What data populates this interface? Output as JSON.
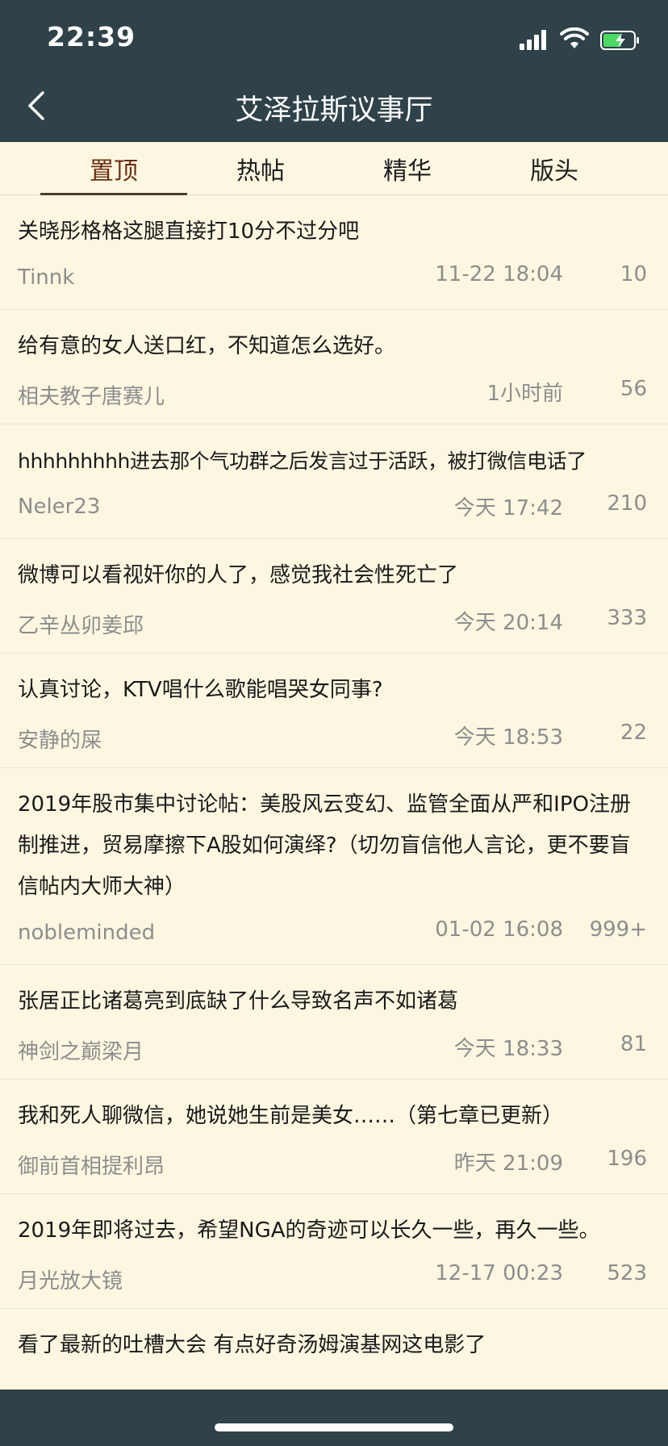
{
  "status_bar": {
    "time": "22:39"
  },
  "header": {
    "title": "艾泽拉斯议事厅"
  },
  "tabs": [
    {
      "label": "置顶",
      "active": true
    },
    {
      "label": "热帖",
      "active": false
    },
    {
      "label": "精华",
      "active": false
    },
    {
      "label": "版头",
      "active": false
    }
  ],
  "posts": [
    {
      "title": "关晓彤格格这腿直接打10分不过分吧",
      "author": "Tinnk",
      "time": "11-22 18:04",
      "count": "10"
    },
    {
      "title": "给有意的女人送口红，不知道怎么选好。",
      "author": "相夫教子唐赛儿",
      "time": "1小时前",
      "count": "56"
    },
    {
      "title": "hhhhhhhhh进去那个气功群之后发言过于活跃，被打微信电话了",
      "author": "Neler23",
      "time": "今天 17:42",
      "count": "210"
    },
    {
      "title": "微博可以看视奸你的人了，感觉我社会性死亡了",
      "author": "乙辛丛卯姜邱",
      "time": "今天 20:14",
      "count": "333"
    },
    {
      "title": "认真讨论，KTV唱什么歌能唱哭女同事?",
      "author": "安静的屎",
      "time": "今天 18:53",
      "count": "22"
    },
    {
      "title": "2019年股市集中讨论帖：美股风云变幻、监管全面从严和IPO注册制推进，贸易摩擦下A股如何演绎?（切勿盲信他人言论，更不要盲信帖内大师大神）",
      "author": "nobleminded",
      "time": "01-02 16:08",
      "count": "999+"
    },
    {
      "title": "张居正比诸葛亮到底缺了什么导致名声不如诸葛",
      "author": "神剑之巅梁月",
      "time": "今天 18:33",
      "count": "81"
    },
    {
      "title": "我和死人聊微信，她说她生前是美女……（第七章已更新）",
      "author": "御前首相提利昂",
      "time": "昨天 21:09",
      "count": "196"
    },
    {
      "title": "2019年即将过去，希望NGA的奇迹可以长久一些，再久一些。",
      "author": "月光放大镜",
      "time": "12-17 00:23",
      "count": "523"
    },
    {
      "title": "看了最新的吐槽大会 有点好奇汤姆演基网这电影了",
      "author": "",
      "time": "",
      "count": ""
    }
  ]
}
